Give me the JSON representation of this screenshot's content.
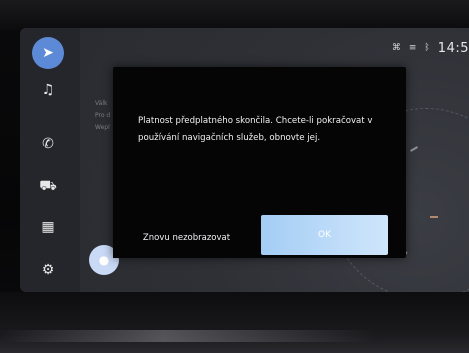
{
  "status_bar": {
    "clock": "14:5",
    "icons": [
      "connectivity-icon",
      "signal-icon",
      "bluetooth-icon"
    ]
  },
  "sidebar": {
    "items": [
      {
        "name": "navigation",
        "icon": "navigation-arrow-icon",
        "glyph": "➤",
        "active": true
      },
      {
        "name": "music",
        "icon": "music-note-icon",
        "glyph": "♫",
        "active": false
      },
      {
        "name": "phone",
        "icon": "phone-icon",
        "glyph": "✆",
        "active": false
      },
      {
        "name": "car",
        "icon": "car-icon",
        "glyph": "⛟",
        "active": false
      },
      {
        "name": "apps",
        "icon": "apps-grid-icon",
        "glyph": "▦",
        "active": false
      },
      {
        "name": "settings",
        "icon": "gear-icon",
        "glyph": "⚙",
        "active": false
      }
    ]
  },
  "background_text": [
    "Välk",
    "Pro d",
    "Wepl"
  ],
  "dialog": {
    "message": "Platnost předplatného skončila. Chcete-li pokračovat v používání navigačních služeb, obnovte jej.",
    "secondary_button": "Znovu nezobrazovat",
    "primary_button": "OK"
  },
  "colors": {
    "accent": "#5d8ad6",
    "primary_button": "#b8dbfa",
    "dialog_bg": "#050506",
    "screen_bg": "#2c2e35"
  }
}
